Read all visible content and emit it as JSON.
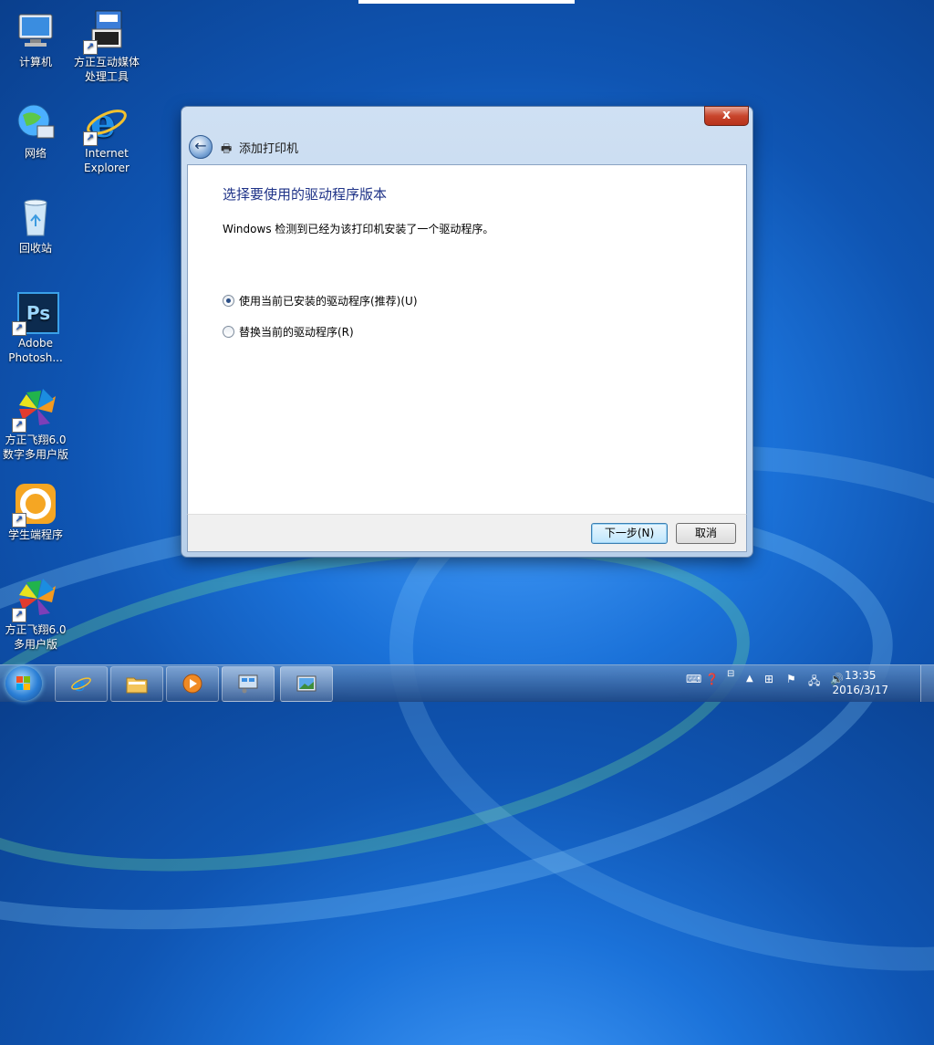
{
  "desktop": {
    "icons": [
      {
        "label_line1": "计算机",
        "label_line2": ""
      },
      {
        "label_line1": "方正互动媒体",
        "label_line2": "处理工具"
      },
      {
        "label_line1": "网络",
        "label_line2": ""
      },
      {
        "label_line1": "Internet",
        "label_line2": "Explorer"
      },
      {
        "label_line1": "回收站",
        "label_line2": ""
      },
      {
        "label_line1": "Adobe",
        "label_line2": "Photosh..."
      },
      {
        "label_line1": "方正飞翔6.0",
        "label_line2": "数字多用户版"
      },
      {
        "label_line1": "学生端程序",
        "label_line2": ""
      },
      {
        "label_line1": "方正飞翔6.0",
        "label_line2": "多用户版"
      }
    ],
    "ps_icon_text": "Ps"
  },
  "dialog": {
    "title": "添加打印机",
    "close_label": "x",
    "heading": "选择要使用的驱动程序版本",
    "description": "Windows 检测到已经为该打印机安装了一个驱动程序。",
    "options": [
      {
        "label": "使用当前已安装的驱动程序(推荐)(U)",
        "selected": true
      },
      {
        "label": "替换当前的驱动程序(R)",
        "selected": false
      }
    ],
    "next_button": "下一步(N)",
    "cancel_button": "取消"
  },
  "taskbar": {
    "time": "13:35",
    "date": "2016/3/17",
    "colors": {
      "start_glow": "#7fd1ff",
      "accent": "#1b72d9"
    }
  }
}
